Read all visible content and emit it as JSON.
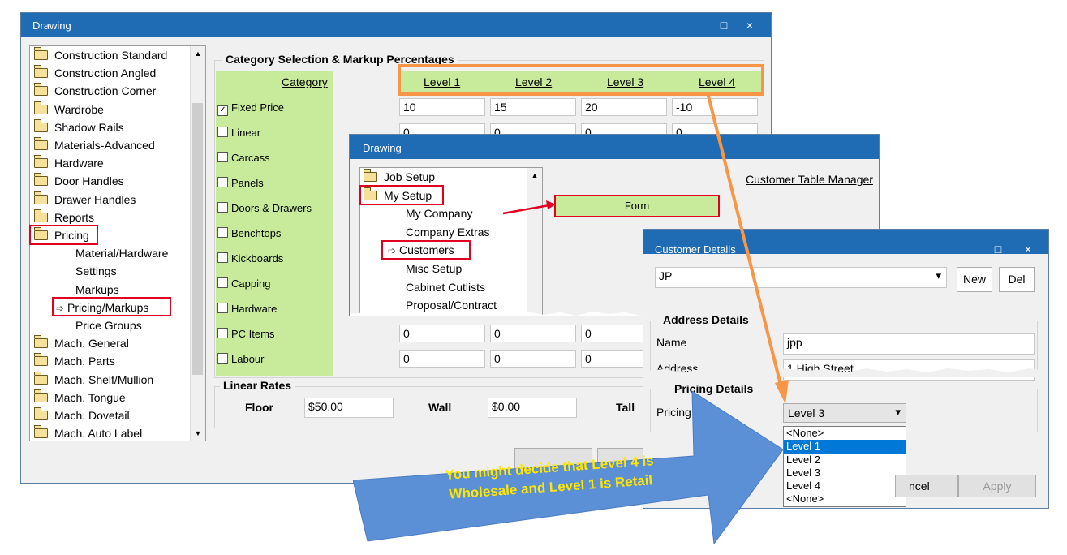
{
  "main_window": {
    "title": "Drawing",
    "maximize_glyph": "□",
    "close_glyph": "×",
    "tree_items": [
      {
        "label": "Construction Standard",
        "icon": "folder-icon"
      },
      {
        "label": "Construction Angled",
        "icon": "folder-icon"
      },
      {
        "label": "Construction Corner",
        "icon": "folder-icon"
      },
      {
        "label": "Wardrobe",
        "icon": "folder-icon"
      },
      {
        "label": "Shadow Rails",
        "icon": "folder-icon"
      },
      {
        "label": "Materials-Advanced",
        "icon": "folder-icon"
      },
      {
        "label": "Hardware",
        "icon": "folder-icon"
      },
      {
        "label": "Door Handles",
        "icon": "folder-icon"
      },
      {
        "label": "Drawer Handles",
        "icon": "folder-icon"
      },
      {
        "label": "Reports",
        "icon": "folder-icon"
      },
      {
        "label": "Pricing",
        "icon": "open-folder-icon"
      },
      {
        "label": "Material/Hardware"
      },
      {
        "label": "Settings"
      },
      {
        "label": "Markups"
      },
      {
        "label": "Pricing/Markups",
        "icon": "arrow-icon"
      },
      {
        "label": "Price Groups"
      },
      {
        "label": "Mach. General",
        "icon": "folder-icon"
      },
      {
        "label": "Mach. Parts",
        "icon": "folder-icon"
      },
      {
        "label": "Mach. Shelf/Mullion",
        "icon": "folder-icon"
      },
      {
        "label": "Mach. Tongue",
        "icon": "folder-icon"
      },
      {
        "label": "Mach. Dovetail",
        "icon": "folder-icon"
      },
      {
        "label": "Mach. Auto Label",
        "icon": "folder-icon"
      }
    ],
    "category_group_title": "Category Selection & Markup Percentages",
    "category_header": "Category",
    "level_headers": [
      "Level 1",
      "Level 2",
      "Level 3",
      "Level 4"
    ],
    "categories": [
      {
        "label": "Fixed Price",
        "checked": true,
        "values": [
          "10",
          "15",
          "20",
          "-10"
        ]
      },
      {
        "label": "Linear",
        "checked": false,
        "values": [
          "0",
          "0",
          "0",
          "0"
        ]
      },
      {
        "label": "Carcass",
        "checked": false,
        "values": []
      },
      {
        "label": "Panels",
        "checked": false,
        "values": []
      },
      {
        "label": "Doors & Drawers",
        "checked": false,
        "values": []
      },
      {
        "label": "Benchtops",
        "checked": false,
        "values": []
      },
      {
        "label": "Kickboards",
        "checked": false,
        "values": []
      },
      {
        "label": "Capping",
        "checked": false,
        "values": []
      },
      {
        "label": "Hardware",
        "checked": false,
        "values": []
      },
      {
        "label": "PC Items",
        "checked": false,
        "values": [
          "0",
          "0",
          "0"
        ]
      },
      {
        "label": "Labour",
        "checked": false,
        "values": [
          "0",
          "0",
          "0"
        ]
      }
    ],
    "check_glyph": "✓",
    "linear_rates_title": "Linear Rates",
    "floor_label": "Floor",
    "floor_value": "$50.00",
    "wall_label": "Wall",
    "wall_value": "$0.00",
    "tall_label": "Tall"
  },
  "drawing_window2": {
    "title": "Drawing",
    "tree_items": [
      {
        "label": "Job Setup",
        "icon": "folder-icon"
      },
      {
        "label": "My Setup",
        "icon": "open-folder-icon"
      },
      {
        "label": "My Company"
      },
      {
        "label": "Company Extras"
      },
      {
        "label": "Customers",
        "icon": "arrow-icon"
      },
      {
        "label": "Misc Setup"
      },
      {
        "label": "Cabinet Cutlists"
      },
      {
        "label": "Proposal/Contract"
      }
    ],
    "customer_table_manager": "Customer Table Manager",
    "form_label": "Form"
  },
  "customer_details": {
    "title": "Customer Details",
    "maximize_glyph": "□",
    "close_glyph": "×",
    "customer_value": "JP",
    "dropdown_glyph": "▾",
    "new_button": "New",
    "del_button": "Del",
    "address_group_title": "Address Details",
    "name_label": "Name",
    "name_value": "jpp",
    "address_label": "Address",
    "address_value": "1 High Street",
    "pricing_group_title": "Pricing Details",
    "pricing_label": "Pricing",
    "pricing_selected": "Level 3",
    "pricing_options": [
      "<None>",
      "Level 1",
      "Level 2",
      "Level 3",
      "Level 4",
      "<None>"
    ],
    "highlighted_option_index": 1,
    "cancel_button": "ncel",
    "apply_button": "Apply"
  },
  "callout": {
    "text_line1": "You might decide that Level 4 is",
    "text_line2": "Wholesale and Level 1 is Retail",
    "fill_color": "#5b8fd6",
    "text_color": "#ffe600"
  },
  "colors": {
    "titlebar": "#1f6cb5",
    "highlight_red": "#e1001f",
    "orange": "#f79646",
    "green": "#c7eb9b",
    "selection_blue": "#0078d7"
  }
}
